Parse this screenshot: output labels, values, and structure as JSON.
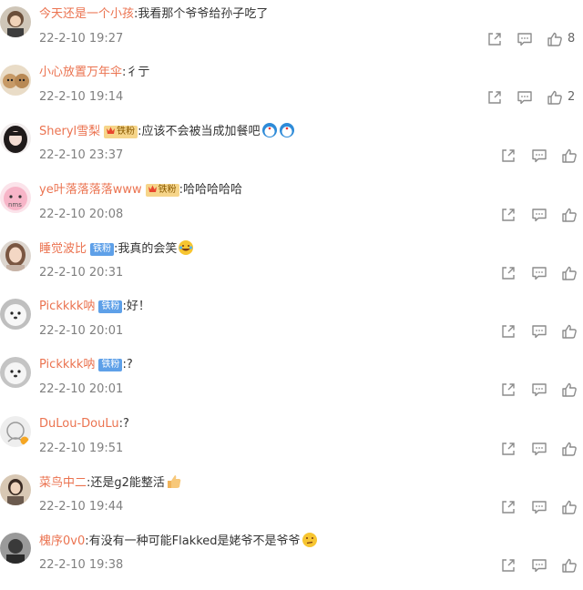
{
  "comments": [
    {
      "username": "今天还是一个小孩",
      "badge": "",
      "sep": ":",
      "text": "我看那个爷爷给孙子吃了",
      "emoji": "",
      "time": "22-2-10 19:27",
      "likes": "8"
    },
    {
      "username": "小心放置万年伞",
      "badge": "",
      "sep": ":",
      "text": "彳亍",
      "emoji": "",
      "time": "22-2-10 19:14",
      "likes": "2"
    },
    {
      "username": "Sheryl雪梨",
      "badge": "铁粉",
      "sep": ":",
      "text": "应该不会被当成加餐吧",
      "emoji": "doraemon-emoji",
      "time": "22-2-10 23:37",
      "likes": ""
    },
    {
      "username": "ye叶落落落落www",
      "badge": "铁粉",
      "sep": ":",
      "text": "哈哈哈哈哈",
      "emoji": "",
      "time": "22-2-10 20:08",
      "likes": ""
    },
    {
      "username": "睡觉波比",
      "badge": "铁粉",
      "sep": ":",
      "text": "我真的会笑",
      "emoji": "laugh-cry-emoji",
      "time": "22-2-10 20:31",
      "likes": ""
    },
    {
      "username": "Pickkkk呐",
      "badge": "铁粉",
      "sep": ":",
      "text": "好！",
      "emoji": "",
      "time": "22-2-10 20:01",
      "likes": ""
    },
    {
      "username": "Pickkkk呐",
      "badge": "铁粉",
      "sep": ":",
      "text": "?",
      "emoji": "",
      "time": "22-2-10 20:01",
      "likes": ""
    },
    {
      "username": "DuLou-DouLu",
      "badge": "",
      "sep": ":",
      "text": "?",
      "emoji": "",
      "time": "22-2-10 19:51",
      "likes": ""
    },
    {
      "username": "菜鸟中二",
      "badge": "",
      "sep": ":",
      "text": "还是g2能整活",
      "emoji": "thumbs-up-emoji",
      "time": "22-2-10 19:44",
      "likes": ""
    },
    {
      "username": "槐序0v0",
      "badge": "",
      "sep": ":",
      "text": "有没有一种可能Flakked是姥爷不是爷爷",
      "emoji": "thinking-emoji",
      "time": "22-2-10 19:38",
      "likes": ""
    }
  ],
  "colors": {
    "username": "#eb7350",
    "text": "#333333",
    "time": "#808080",
    "badge_blue": "#5ea0e8",
    "badge_gold": "#f6d58a",
    "icon": "#8c8c8c"
  },
  "icons": {
    "share": "share-icon",
    "comment": "comment-icon",
    "like": "thumbs-up-icon"
  }
}
